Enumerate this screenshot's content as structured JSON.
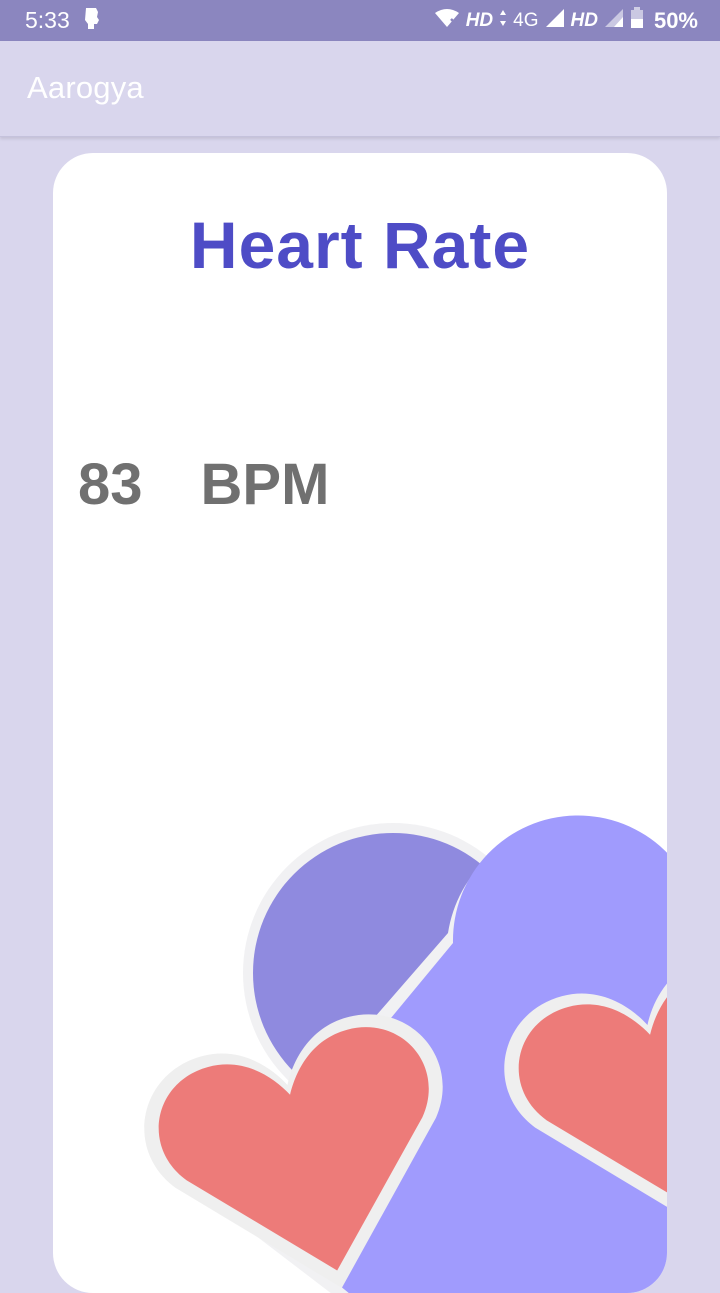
{
  "status_bar": {
    "time": "5:33",
    "network_label_1": "HD",
    "network_type": "4G",
    "network_label_2": "HD",
    "battery": "50%"
  },
  "app_bar": {
    "title": "Aarogya"
  },
  "card": {
    "title": "Heart Rate",
    "bpm_value": "83",
    "bpm_unit": "BPM"
  },
  "colors": {
    "status_bar": "#8b86bf",
    "background": "#d9d6ed",
    "title": "#4e4cc6",
    "bpm_text": "#707070",
    "heart_dark_purple": "#8f8adf",
    "heart_light_purple": "#a09bfd",
    "heart_red": "#ed7b79"
  },
  "icons": [
    "notification-fist-icon",
    "wifi-x-icon",
    "data-arrows-icon",
    "signal-icon",
    "signal-icon",
    "battery-icon"
  ]
}
